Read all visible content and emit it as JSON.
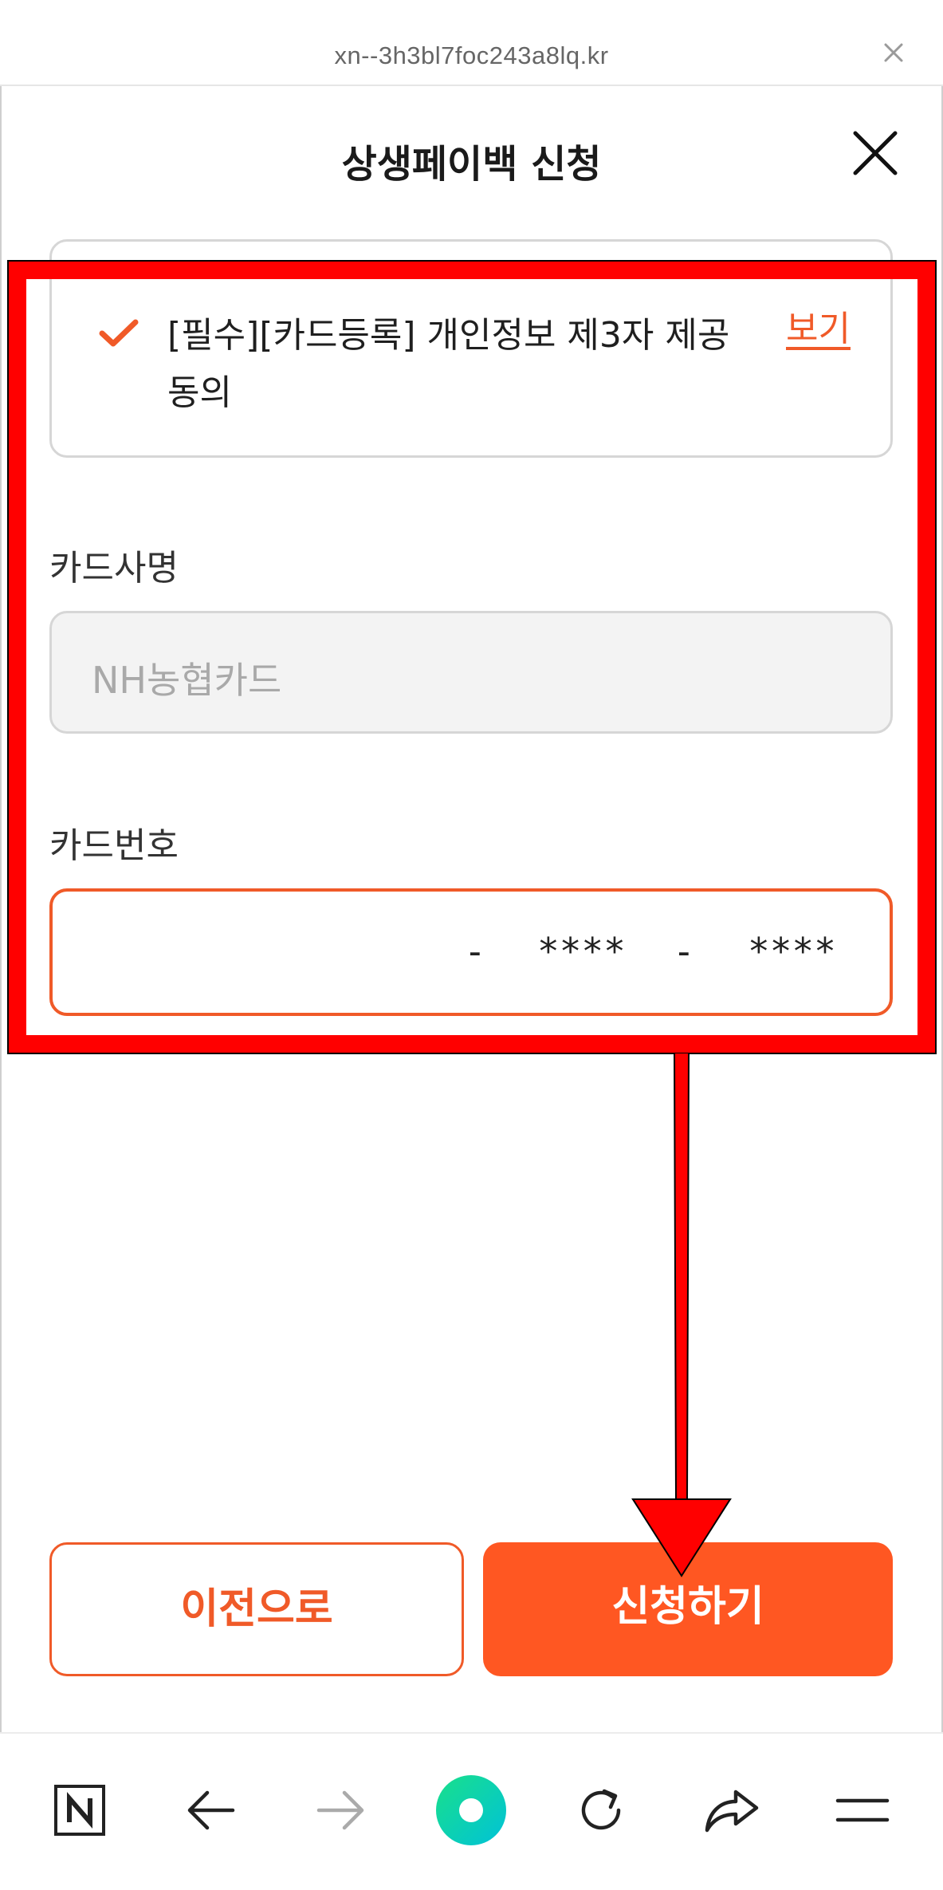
{
  "browser": {
    "url": "xn--3h3bl7foc243a8lq.kr"
  },
  "header": {
    "title": "상생페이백 신청"
  },
  "agreement": {
    "text": "[필수][카드등록] 개인정보 제3자 제공 동의",
    "view_label": "보기"
  },
  "card_company": {
    "label": "카드사명",
    "placeholder": "NH농협카드"
  },
  "card_number": {
    "label": "카드번호",
    "separator": "-",
    "segment2": "****",
    "segment3": "****"
  },
  "buttons": {
    "prev_label": "이전으로",
    "submit_label": "신청하기"
  },
  "bottom_nav": {
    "icons": [
      "naver-n-icon",
      "back-arrow-icon",
      "forward-arrow-icon",
      "home-circle-icon",
      "refresh-icon",
      "share-icon",
      "menu-icon"
    ]
  },
  "colors": {
    "accent": "#ff5722",
    "highlight": "#ff0000",
    "arrow": "#ff0000"
  }
}
